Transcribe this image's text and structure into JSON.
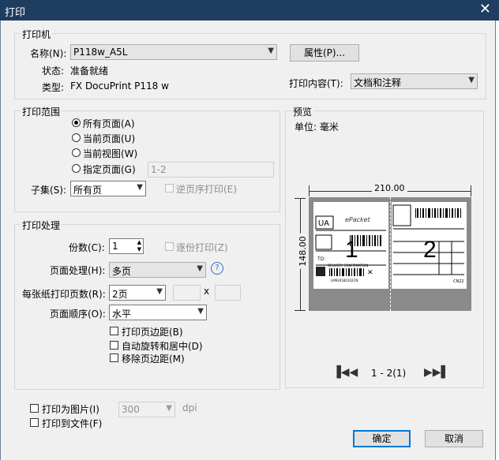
{
  "window": {
    "title": "打印",
    "close_glyph": "✕"
  },
  "printer": {
    "group_title": "打印机",
    "name_label": "名称(N):",
    "name_value": "P118w_A5L",
    "status_label": "状态:",
    "status_value": "准备就绪",
    "type_label": "类型:",
    "type_value": "FX DocuPrint P118 w",
    "properties_button": "属性(P)...",
    "print_content_label": "打印内容(T):",
    "print_content_value": "文档和注释"
  },
  "range": {
    "group_title": "打印范围",
    "options": [
      "所有页面(A)",
      "当前页面(U)",
      "当前视图(W)",
      "指定页面(G)"
    ],
    "selected_index": 0,
    "pages_placeholder": "1-2",
    "subset_label": "子集(S):",
    "subset_value": "所有页",
    "reverse_label": "逆页序打印(E)"
  },
  "handling": {
    "group_title": "打印处理",
    "copies_label": "份数(C):",
    "copies_value": "1",
    "collate_label": "逐份打印(Z)",
    "page_handling_label": "页面处理(H):",
    "page_handling_value": "多页",
    "pages_per_sheet_label": "每张纸打印页数(R):",
    "pages_per_sheet_value": "2页",
    "x_sep": "x",
    "page_order_label": "页面顺序(O):",
    "page_order_value": "水平",
    "print_border_label": "打印页边距(B)",
    "auto_rotate_label": "自动旋转和居中(D)",
    "remove_margin_label": "移除页边距(M)"
  },
  "bottom": {
    "print_as_image_label": "打印为图片(I)",
    "dpi_value": "300",
    "dpi_unit": "dpi",
    "print_to_file_label": "打印到文件(F)",
    "ok_button": "确定",
    "cancel_button": "取消"
  },
  "preview": {
    "group_title": "预览",
    "unit_label": "单位: 毫米",
    "width_dim": "210.00",
    "height_dim": "148.00",
    "page1_num": "1",
    "page2_num": "2",
    "page_indicator": "1 - 2(1)",
    "label1_brand": "ePacket",
    "label1_ua": "UA",
    "label1_to": "TO:",
    "label1_title": "DELIVERY CONFIRMATION",
    "label1_barcode_text": "LM920181032CN",
    "label2_footer": "CN22"
  }
}
